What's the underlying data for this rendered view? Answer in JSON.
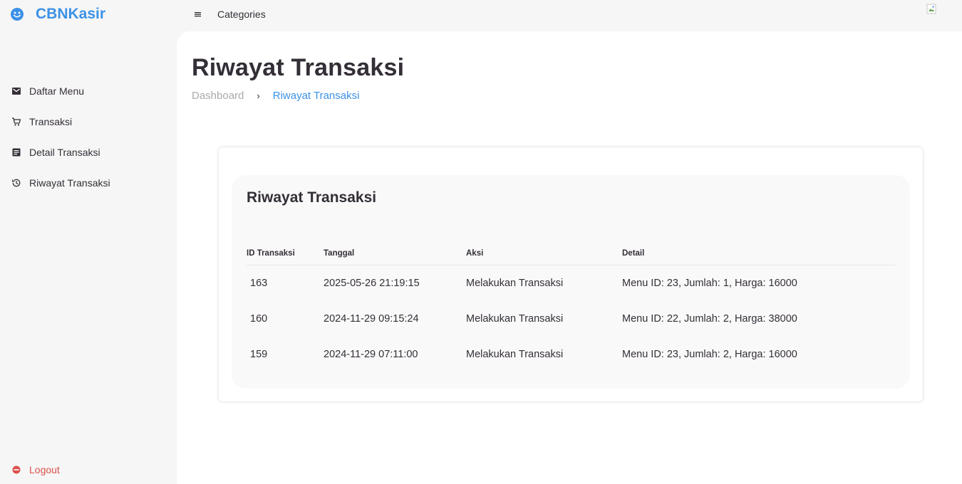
{
  "app": {
    "brand": "CBNKasir"
  },
  "topnav": {
    "categories": "Categories"
  },
  "sidebar": {
    "items": [
      {
        "label": "Daftar Menu",
        "icon": "store-icon"
      },
      {
        "label": "Transaksi",
        "icon": "cart-icon"
      },
      {
        "label": "Detail Transaksi",
        "icon": "receipt-icon"
      },
      {
        "label": "Riwayat Transaksi",
        "icon": "history-icon"
      }
    ],
    "logout": "Logout"
  },
  "header": {
    "title": "Riwayat Transaksi",
    "breadcrumb": {
      "home": "Dashboard",
      "separator": "›",
      "current": "Riwayat Transaksi"
    }
  },
  "card": {
    "title": "Riwayat Transaksi",
    "columns": [
      "ID Transaksi",
      "Tanggal",
      "Aksi",
      "Detail"
    ],
    "rows": [
      [
        "163",
        "2025-05-26 21:19:15",
        "Melakukan Transaksi",
        "Menu ID: 23, Jumlah: 1, Harga: 16000"
      ],
      [
        "160",
        "2024-11-29 09:15:24",
        "Melakukan Transaksi",
        "Menu ID: 22, Jumlah: 2, Harga: 38000"
      ],
      [
        "159",
        "2024-11-29 07:11:00",
        "Melakukan Transaksi",
        "Menu ID: 23, Jumlah: 2, Harga: 16000"
      ]
    ]
  },
  "colors": {
    "accent": "#3c91e6",
    "danger": "#db504a",
    "text": "#342e37",
    "muted": "#aaaaaa"
  }
}
